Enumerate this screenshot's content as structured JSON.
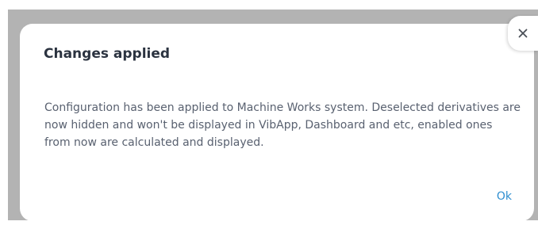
{
  "dialog": {
    "title": "Changes applied",
    "message": "Configuration has been applied to Machine Works system. Deselected derivatives are now hidden and won't be displayed in VibApp, Dashboard and etc, enabled ones from now are calculated and displayed.",
    "ok_label": "Ok",
    "close_icon": "close-icon"
  },
  "colors": {
    "overlay": "#b3b3b3",
    "title": "#2b3340",
    "text": "#596170",
    "accent": "#2f8fd0"
  }
}
